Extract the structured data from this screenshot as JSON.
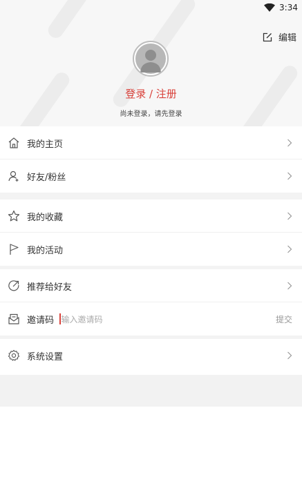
{
  "status": {
    "time": "3:34"
  },
  "profile": {
    "edit_label": "编辑",
    "login_label": "登录 / 注册",
    "hint": "尚未登录，请先登录"
  },
  "menu": {
    "home": "我的主页",
    "friends": "好友/粉丝",
    "favorites": "我的收藏",
    "activities": "我的活动",
    "recommend": "推荐给好友",
    "settings": "系统设置"
  },
  "invite": {
    "label": "邀请码",
    "placeholder": "输入邀请码",
    "submit": "提交"
  },
  "colors": {
    "accent": "#d9413a",
    "background": "#f3f3f3"
  }
}
